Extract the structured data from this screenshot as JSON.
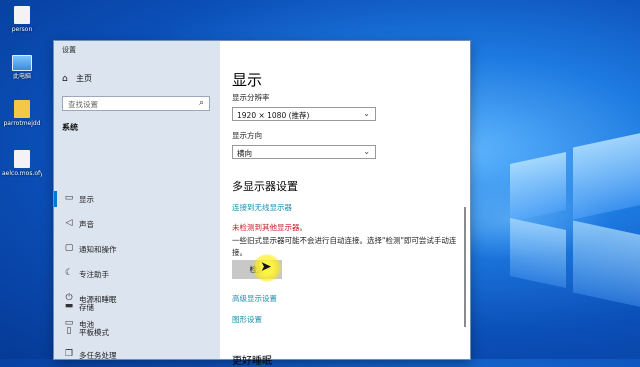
{
  "desktop": {
    "icons": [
      {
        "label": "person",
        "kind": "file"
      },
      {
        "label": "此电脑",
        "kind": "pc"
      },
      {
        "label": "parrotmejdd",
        "kind": "folder"
      },
      {
        "label": "aelco.mos.ofy",
        "kind": "file"
      }
    ]
  },
  "window": {
    "title": "设置",
    "controls": {
      "minimize": "—",
      "maximize": "☐",
      "close": "✕"
    }
  },
  "sidebar": {
    "home": "主页",
    "search_placeholder": "查找设置",
    "section": "系统",
    "items": [
      {
        "label": "显示",
        "icon": "monitor-icon",
        "glyph": "▭",
        "selected": true
      },
      {
        "label": "声音",
        "icon": "speaker-icon",
        "glyph": "◁",
        "selected": false
      },
      {
        "label": "通知和操作",
        "icon": "notification-icon",
        "glyph": "▢",
        "selected": false
      },
      {
        "label": "专注助手",
        "icon": "moon-icon",
        "glyph": "☾",
        "selected": false
      },
      {
        "label": "电源和睡眠",
        "icon": "power-icon",
        "glyph": "⏻",
        "selected": false
      },
      {
        "label": "电池",
        "icon": "battery-icon",
        "glyph": "▭",
        "selected": false
      },
      {
        "label": "存储",
        "icon": "storage-icon",
        "glyph": "▬",
        "selected": false
      },
      {
        "label": "平板模式",
        "icon": "tablet-icon",
        "glyph": "▯",
        "selected": false
      },
      {
        "label": "多任务处理",
        "icon": "multitask-icon",
        "glyph": "❐",
        "selected": false
      }
    ]
  },
  "main": {
    "title": "显示",
    "resolution_label": "显示分辨率",
    "resolution_value": "1920 × 1080 (推荐)",
    "orientation_label": "显示方向",
    "orientation_value": "横向",
    "multi_display_heading": "多显示器设置",
    "wireless_link": "连接到无线显示器",
    "warning": "未检测到其他显示器。",
    "description": "一些旧式显示器可能不会进行自动连接。选择\"检测\"即可尝试手动连接。",
    "detect_button": "检测",
    "advanced_link": "高级显示设置",
    "graphics_link": "图形设置",
    "next_heading": "更好睡眠"
  }
}
